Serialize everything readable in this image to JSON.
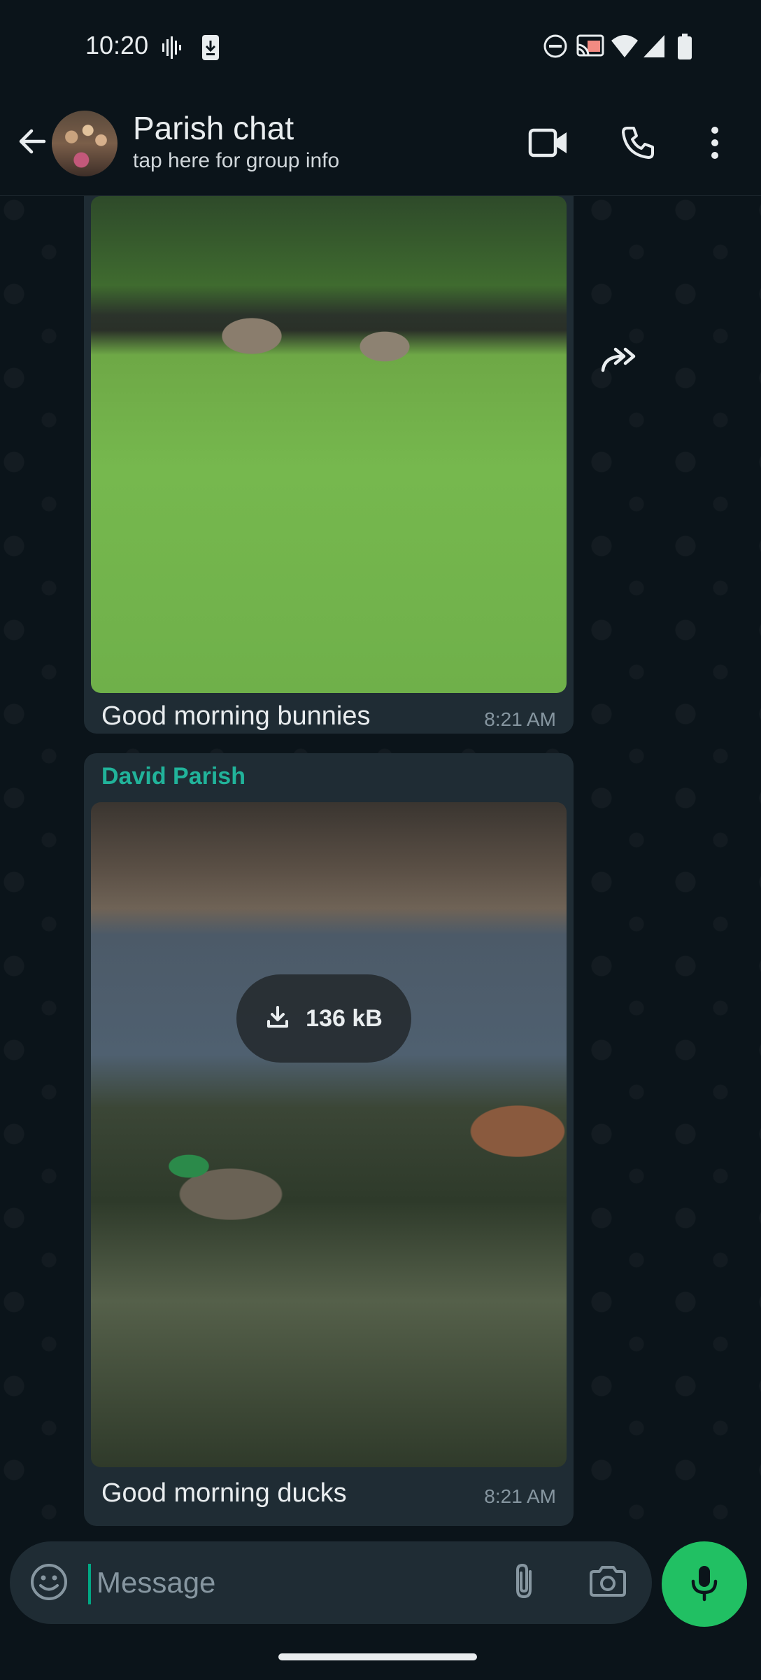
{
  "status_bar": {
    "time": "10:20",
    "icons": [
      "voicemail-icon",
      "download-icon",
      "dnd-icon",
      "cast-icon",
      "wifi-icon",
      "signal-icon",
      "battery-icon"
    ]
  },
  "header": {
    "title": "Parish chat",
    "subtitle": "tap here for group info",
    "icons": [
      "back-arrow-icon",
      "group-avatar",
      "video-call-icon",
      "voice-call-icon",
      "more-options-icon"
    ]
  },
  "messages": [
    {
      "type": "image",
      "caption": "Good morning bunnies",
      "time": "8:21 AM"
    },
    {
      "type": "image",
      "sender": "David Parish",
      "download_size": "136 kB",
      "caption": "Good morning ducks",
      "time": "8:21 AM"
    }
  ],
  "composer": {
    "placeholder": "Message"
  },
  "colors": {
    "background": "#0b141a",
    "bubble": "#1f2c34",
    "accent": "#21c063",
    "sender_name": "#21b39a",
    "secondary_text": "#8696a0"
  }
}
